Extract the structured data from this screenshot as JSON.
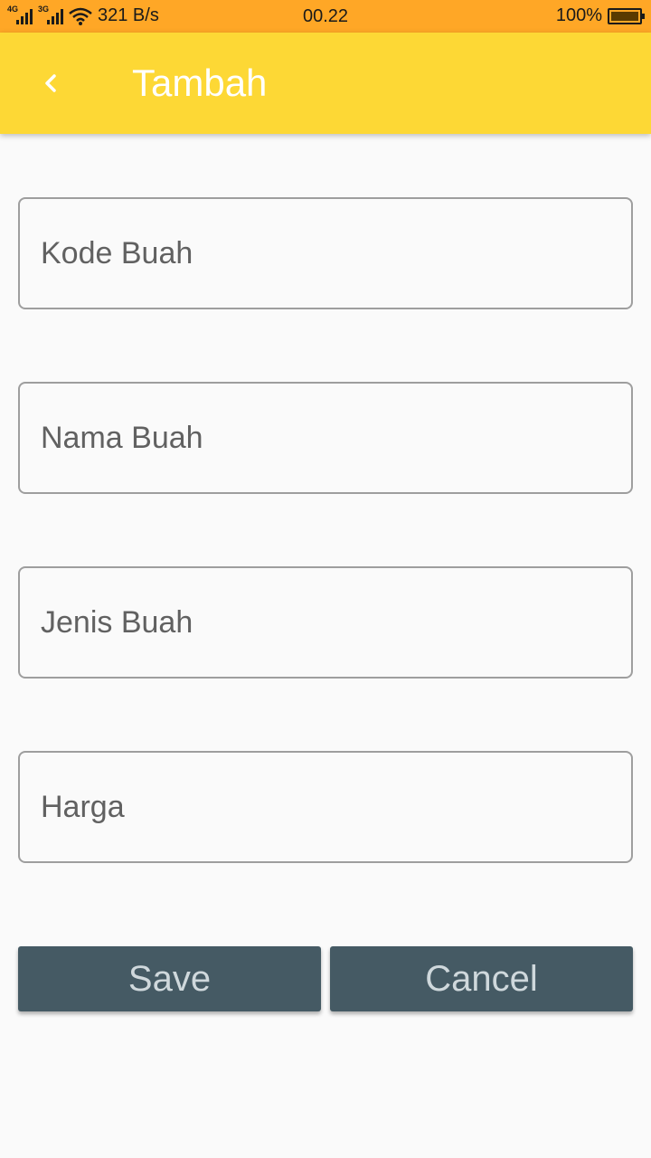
{
  "status_bar": {
    "net_tag_1": "4G",
    "net_tag_2": "3G",
    "speed": "321 B/s",
    "time": "00.22",
    "battery": "100%"
  },
  "app_bar": {
    "title": "Tambah",
    "back_icon": "chevron-left-icon"
  },
  "form": {
    "fields": [
      {
        "placeholder": "Kode Buah",
        "value": ""
      },
      {
        "placeholder": "Nama Buah",
        "value": ""
      },
      {
        "placeholder": "Jenis Buah",
        "value": ""
      },
      {
        "placeholder": "Harga",
        "value": ""
      }
    ],
    "save_label": "Save",
    "cancel_label": "Cancel"
  },
  "colors": {
    "status_bar": "#ffa726",
    "app_bar": "#fdd835",
    "button": "#455a64",
    "button_text": "#cfd8dc",
    "background": "#fafafa"
  }
}
